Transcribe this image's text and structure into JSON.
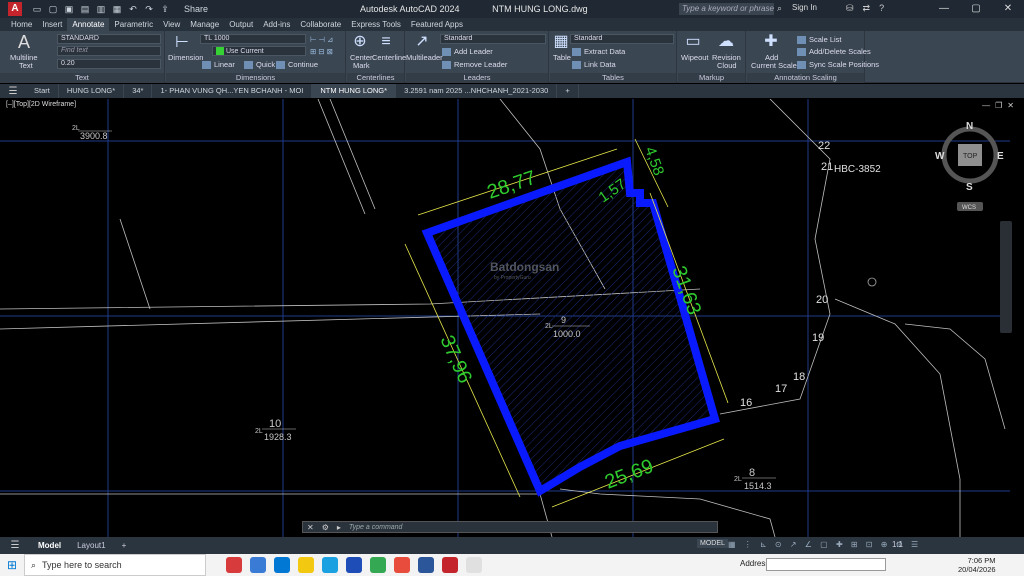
{
  "titlebar": {
    "app_icon": "A",
    "share": "Share",
    "app_title": "Autodesk AutoCAD 2024",
    "file_title": "NTM HUNG LONG.dwg",
    "search_placeholder": "Type a keyword or phrase",
    "signin": "Sign In"
  },
  "menu_tabs": [
    "Home",
    "Insert",
    "Annotate",
    "Parametric",
    "View",
    "Manage",
    "Output",
    "Add-ins",
    "Collaborate",
    "Express Tools",
    "Featured Apps"
  ],
  "ribbon": {
    "text_panel": {
      "title": "Text",
      "multiline": "Multiline",
      "multiline2": "Text",
      "style": "STANDARD",
      "find": "Find text",
      "height": "0.20"
    },
    "dim_panel": {
      "title": "Dimensions",
      "dimension": "Dimension",
      "dimstyle": "TL 1000",
      "layer": "Use Current",
      "linear": "Linear",
      "quick": "Quick",
      "continue": "Continue"
    },
    "center_panel": {
      "title": "Centerlines",
      "center_mark": "Center",
      "center_mark2": "Mark",
      "centerline": "Centerline"
    },
    "leaders_panel": {
      "title": "Leaders",
      "multileader": "Multileader",
      "style": "Standard",
      "add": "Add Leader",
      "remove": "Remove Leader"
    },
    "tables_panel": {
      "title": "Tables",
      "table": "Table",
      "style": "Standard",
      "extract": "Extract Data",
      "link": "Link Data"
    },
    "markup_panel": {
      "title": "Markup",
      "wipeout": "Wipeout",
      "revision": "Revision",
      "revision2": "Cloud"
    },
    "scaling_panel": {
      "title": "Annotation Scaling",
      "add_current": "Add",
      "add_current2": "Current Scale",
      "scale_list": "Scale List",
      "add_delete": "Add/Delete Scales",
      "sync": "Sync Scale Positions"
    }
  },
  "file_tabs": [
    "Start",
    "HUNG LONG*",
    "34*",
    "1- PHAN VUNG QH...YEN BCHANH - MOI",
    "NTM HUNG LONG*",
    "3.2591 nam 2025 ...NHCHANH_2021-2030"
  ],
  "view_label": "[–][Top][2D Wireframe]",
  "drawing": {
    "dims": {
      "top": "28,77",
      "right": "31,63",
      "bottom": "25,69",
      "left": "37,96",
      "corner_a": "4,58",
      "corner_b": "1,57"
    },
    "parcels": [
      {
        "prefix": "2L",
        "num": "",
        "area": "3900.8"
      },
      {
        "prefix": "2L",
        "num": "9",
        "area": "1000.0"
      },
      {
        "prefix": "2L",
        "num": "10",
        "area": "1928.3"
      },
      {
        "prefix": "2L",
        "num": "8",
        "area": "1514.3"
      }
    ],
    "points": [
      "22",
      "21",
      "20",
      "19",
      "18",
      "17",
      "16"
    ],
    "road_label": "HBC-3852",
    "watermark": "Batdongsan",
    "watermark_sub": "by PropertyGuru",
    "viewcube": {
      "n": "N",
      "s": "S",
      "e": "E",
      "w": "W",
      "top": "TOP",
      "wcs": "WCS"
    }
  },
  "command": {
    "placeholder": "Type a command"
  },
  "layout_tabs": [
    "Model",
    "Layout1"
  ],
  "status": {
    "model": "MODEL",
    "scale": "1:1"
  },
  "taskbar": {
    "search": "Type here to search",
    "address": "Address",
    "time": "7:06 PM",
    "date": "20/04/2026"
  },
  "colors": {
    "parcel": "#0a1aff",
    "dims": "#2ecb2e",
    "ribbon": "#3b4653"
  }
}
